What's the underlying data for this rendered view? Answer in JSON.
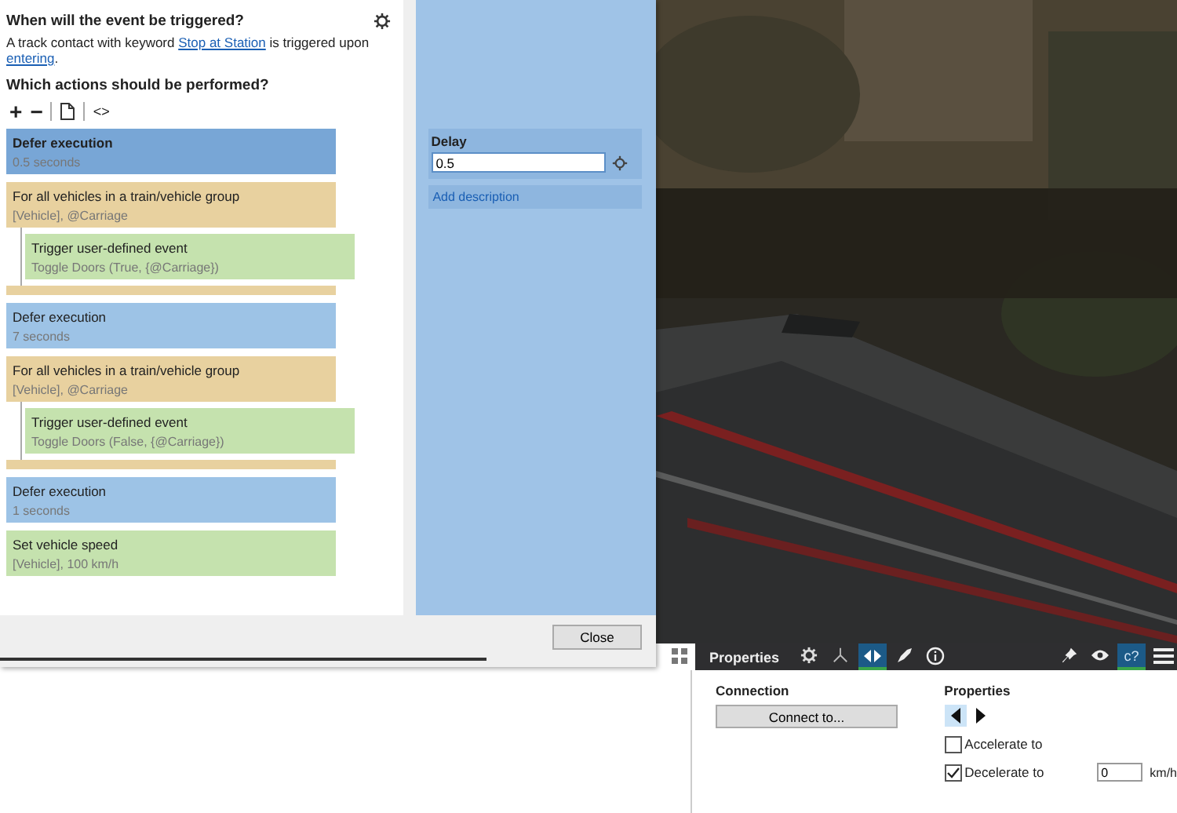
{
  "dialog": {
    "trigger_heading": "When will the event be triggered?",
    "trigger_sentence": {
      "before": "A track contact with keyword",
      "keyword_link": "Stop at Station",
      "middle": "is triggered upon",
      "mode_link": "entering",
      "end": "."
    },
    "actions_heading": "Which actions should be performed?",
    "toolbar": {
      "add": "+",
      "remove": "−",
      "code": "<>"
    },
    "actions": [
      {
        "kind": "defer",
        "title": "Defer execution",
        "detail": "0.5 seconds",
        "selected": true
      },
      {
        "kind": "loop",
        "title": "For all vehicles in a train/vehicle group",
        "detail": "[Vehicle], @Carriage",
        "selected": false,
        "children": [
          {
            "kind": "event",
            "title": "Trigger user-defined event",
            "detail": "Toggle Doors (True, {@Carriage})",
            "selected": false
          }
        ]
      },
      {
        "kind": "defer",
        "title": "Defer execution",
        "detail": "7 seconds",
        "selected": false
      },
      {
        "kind": "loop",
        "title": "For all vehicles in a train/vehicle group",
        "detail": "[Vehicle], @Carriage",
        "selected": false,
        "children": [
          {
            "kind": "event",
            "title": "Trigger user-defined event",
            "detail": "Toggle Doors (False, {@Carriage})",
            "selected": false
          }
        ]
      },
      {
        "kind": "defer",
        "title": "Defer execution",
        "detail": "1 seconds",
        "selected": false
      },
      {
        "kind": "event",
        "title": "Set vehicle speed",
        "detail": "[Vehicle], 100 km/h",
        "selected": false
      }
    ],
    "delay": {
      "label": "Delay",
      "value": "0.5",
      "add_description": "Add description"
    },
    "close_button": "Close"
  },
  "panel_toolbar": {
    "title": "Properties",
    "tabs": [
      {
        "kind": "gear",
        "selected": false
      },
      {
        "kind": "nodes",
        "selected": false
      },
      {
        "kind": "arrows",
        "selected": true
      },
      {
        "kind": "brush",
        "selected": false
      },
      {
        "kind": "info",
        "selected": false
      }
    ],
    "right_tools": [
      {
        "kind": "pin",
        "selected": false
      },
      {
        "kind": "eye",
        "selected": false
      },
      {
        "kind": "help",
        "label": "c?",
        "selected": true
      },
      {
        "kind": "menu",
        "selected": false
      }
    ]
  },
  "properties_panel": {
    "connection_heading": "Connection",
    "connect_button": "Connect to...",
    "properties_heading": "Properties",
    "directions": [
      {
        "kind": "left",
        "selected": true
      },
      {
        "kind": "right",
        "selected": false
      }
    ],
    "options": [
      {
        "label": "Accelerate to",
        "checked": false
      },
      {
        "label": "Decelerate to",
        "checked": true,
        "value": "0",
        "unit": "km/h"
      }
    ]
  }
}
